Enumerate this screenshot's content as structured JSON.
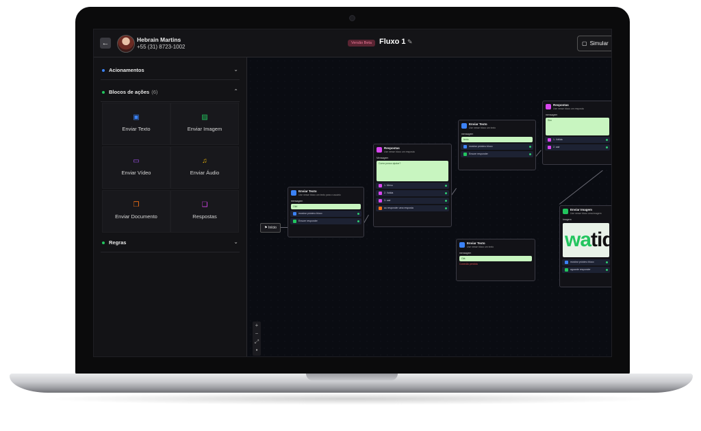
{
  "header": {
    "user_name": "Hebrain Martins",
    "user_phone": "+55 (31) 8723-1002",
    "version_badge": "Versão Beta",
    "flow_title": "Fluxo 1",
    "simulate_label": "Simular"
  },
  "sidebar": {
    "sections": [
      {
        "label": "Acionamentos",
        "color": "#3b82f6"
      },
      {
        "label": "Blocos de ações",
        "count": "(6)",
        "color": "#22c55e"
      },
      {
        "label": "Regras",
        "color": "#22c55e"
      }
    ],
    "blocks": [
      {
        "label": "Enviar Texto",
        "icon": "text-message-icon",
        "color": "#3b82f6"
      },
      {
        "label": "Enviar Imagem",
        "icon": "image-icon",
        "color": "#22c55e"
      },
      {
        "label": "Enviar Vídeo",
        "icon": "video-icon",
        "color": "#a855f7"
      },
      {
        "label": "Enviar Áudio",
        "icon": "audio-file-icon",
        "color": "#eab308"
      },
      {
        "label": "Enviar Documento",
        "icon": "document-icon",
        "color": "#f97316"
      },
      {
        "label": "Respostas",
        "icon": "chat-bubbles-icon",
        "color": "#d946ef"
      }
    ]
  },
  "canvas": {
    "start_label": "Início",
    "logo_text_a": "wa",
    "logo_text_b": "tid",
    "nodes": {
      "n1": {
        "title": "Enviar Texto",
        "sub": "Use nesse bloco um texto para o usuário",
        "field": "mensagem",
        "value": "Olá!",
        "opt1": "mostrar próximo bloco",
        "opt2": "Ensure responder"
      },
      "n2": {
        "title": "Respostas",
        "sub": "Use nesse bloco um resposta",
        "field": "Mensagem",
        "value": "Como posso ajudar?",
        "opts": [
          "1. Menu",
          "2. Valida",
          "3. sair",
          "ao responder uma resposta"
        ]
      },
      "n3": {
        "title": "Enviar Texto",
        "sub": "Use nesse bloco um texto",
        "field": "mensagem",
        "value": "texto",
        "opt1": "mostrar próximo bloco",
        "opt2": "Ensure responder"
      },
      "n4": {
        "title": "Respostas",
        "sub": "Use nesse bloco um resposta",
        "field": "mensagem",
        "value": "Sim",
        "opts": [
          "1. Válida",
          "2. sair"
        ]
      },
      "n5": {
        "title": "Enviar Texto",
        "sub": "Use nesse bloco um texto",
        "field": "mensagem",
        "value": "Olá",
        "error": "Conexão perdida"
      },
      "n6": {
        "title": "Enviar Imagem",
        "sub": "Use nesse bloco uma imagem",
        "field": "Imagem",
        "opt1": "mostrar próximo bloco",
        "opt2": "aguarde responder"
      }
    }
  }
}
